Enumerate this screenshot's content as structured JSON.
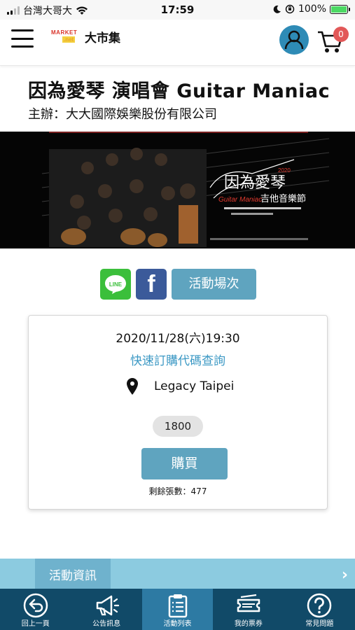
{
  "status_bar": {
    "carrier": "台灣大哥大",
    "time": "17:59",
    "battery": "100%"
  },
  "header": {
    "logo_text": "大市集",
    "logo_mark": "MARKET",
    "logo_mark_sub": ".net",
    "cart_count": "0"
  },
  "event": {
    "title": "因為愛琴 演唱會 Guitar Maniac",
    "organizer": "主辦：大大國際娛樂股份有限公司"
  },
  "banner": {
    "headline": "因為愛琴",
    "subtitle": "Guitar Maniac",
    "subline": "吉他音樂節",
    "year": "2020"
  },
  "actions": {
    "line_label": "LINE",
    "facebook_label": "f",
    "sessions_label": "活動場次"
  },
  "session": {
    "datetime": "2020/11/28(六)19:30",
    "code_lookup": "快速訂購代碼查詢",
    "venue": "Legacy Taipei",
    "price": "1800",
    "buy_label": "購買",
    "remaining": "剩餘張數：477"
  },
  "info_bar": {
    "label": "活動資訊",
    "arrow": "›"
  },
  "bottom_nav": {
    "items": [
      {
        "label": "回上一頁",
        "icon": "back-arrow-icon"
      },
      {
        "label": "公告訊息",
        "icon": "megaphone-icon"
      },
      {
        "label": "活動列表",
        "icon": "clipboard-list-icon"
      },
      {
        "label": "我的票券",
        "icon": "ticket-icon"
      },
      {
        "label": "常見問題",
        "icon": "question-icon"
      }
    ],
    "active_index": 2
  },
  "colors": {
    "accent": "#5fa4bf",
    "link": "#3b98c4",
    "nav_bg": "#114a68",
    "nav_active": "#2d7aa3",
    "info_bar": "#8ccbe0",
    "line_green": "#3bbf3b",
    "facebook_blue": "#3b5a9a",
    "avatar_blue": "#2e8bb6",
    "badge_red": "#e25858"
  }
}
